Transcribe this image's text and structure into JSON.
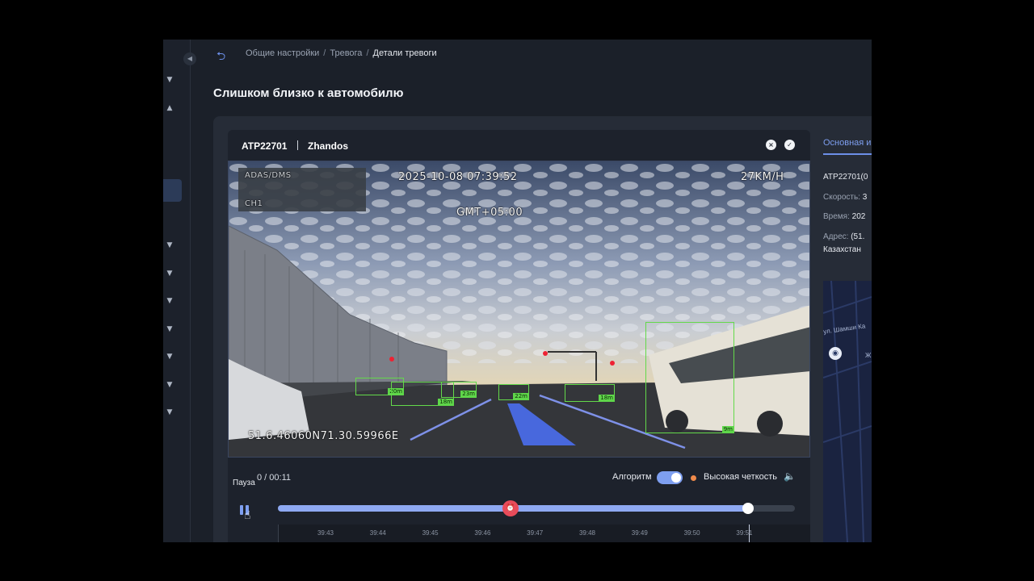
{
  "breadcrumb": {
    "items": [
      "Общие настройки",
      "Тревога"
    ],
    "current": "Детали тревоги",
    "separator": "/"
  },
  "page": {
    "title": "Слишком близко к автомобилю"
  },
  "player": {
    "plate": "ATP22701",
    "driver": "Zhandos",
    "close_icon": "×",
    "confirm_icon": "✓",
    "osd": {
      "datetime": "2025-10-08 07:39:52",
      "speed": "27KM/H",
      "timezone": "GMT+05:00",
      "coords": "51.6.46060N71.30.59966E",
      "camera": "CH1",
      "logo_text": "ADAS/DMS"
    },
    "detections": [
      "20m",
      "18m",
      "23m",
      "22m",
      "18m",
      "9m"
    ],
    "time": "0 / 00:11",
    "pause_label": "Пауза",
    "algo_label": "Алгоритм",
    "algo_on": true,
    "hd_label": "Высокая четкость",
    "progress": 0.91,
    "alarm_at": 0.45,
    "timeline_ticks": [
      "39:43",
      "39:44",
      "39:45",
      "39:46",
      "39:47",
      "39:48",
      "39:49",
      "39:50",
      "39:51"
    ]
  },
  "info": {
    "tab": "Основная и",
    "plate_line": "ATP22701(0",
    "speed_label": "Скорость:",
    "speed_value": "3",
    "time_label": "Время:",
    "time_value": "202",
    "address_label": "Адрес:",
    "address_value": "(51.",
    "address_line2": "Казахстан",
    "map_street": "ул. Шамши Ка",
    "map_z": "Ж"
  },
  "colors": {
    "accent": "#7e9ff0",
    "detection": "#63d94a",
    "alarm": "#e84b5a",
    "hd_dot": "#f08a4b"
  }
}
